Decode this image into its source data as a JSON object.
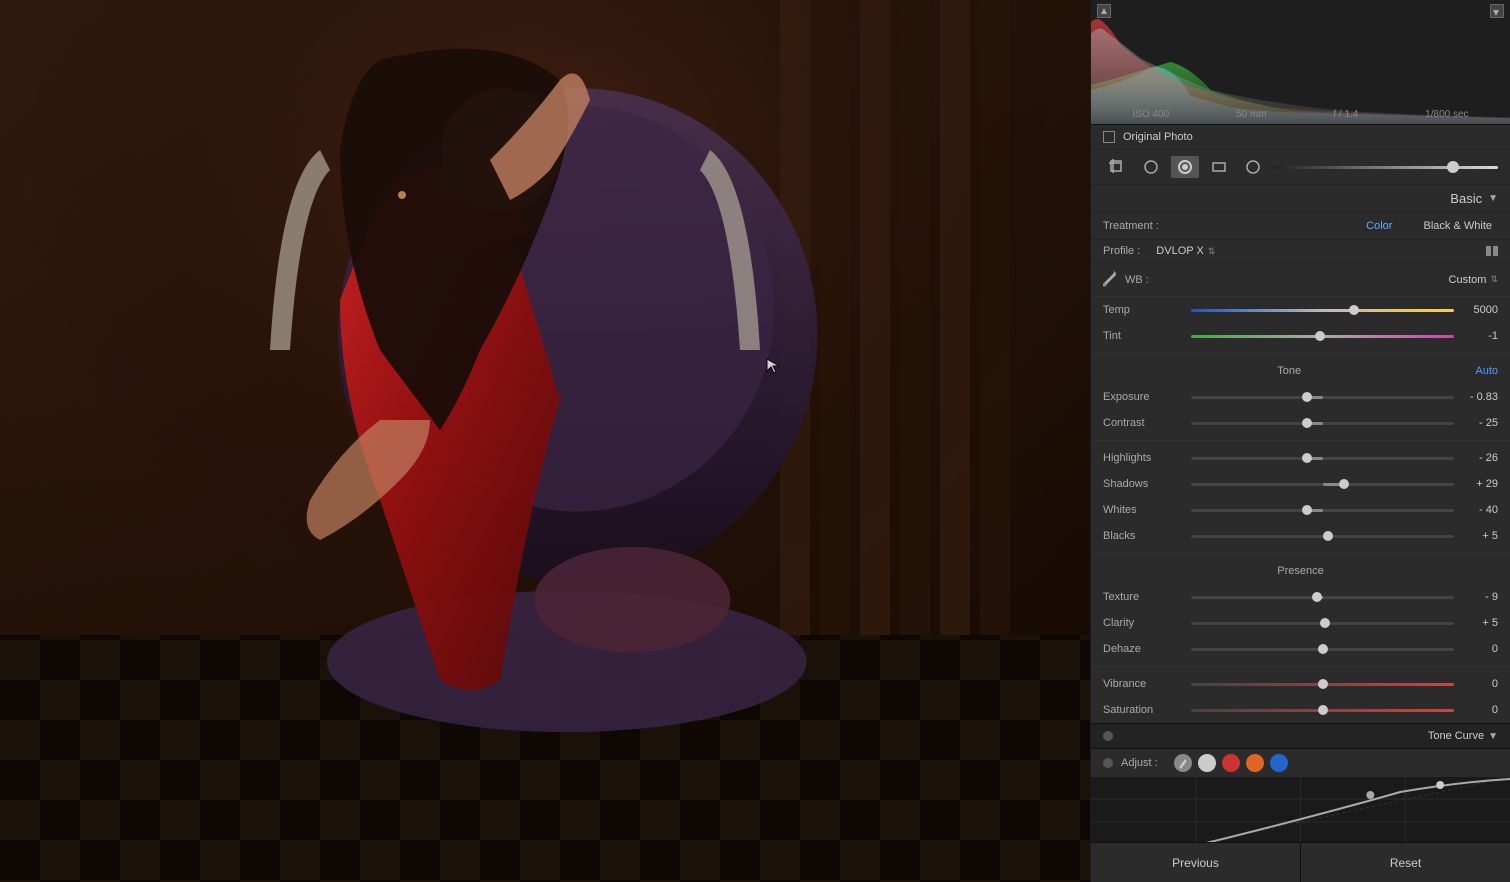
{
  "photo": {
    "alt": "Woman in red dress sitting on ornate chair"
  },
  "histogram": {
    "meta_iso": "ISO 400",
    "meta_focal": "50 mm",
    "meta_aperture": "f / 1.4",
    "meta_shutter": "1/800 sec"
  },
  "original_photo": {
    "label": "Original Photo"
  },
  "panel": {
    "section_title": "Basic",
    "section_title_tone_curve": "Tone Curve",
    "treatment_label": "Treatment :",
    "treatment_color": "Color",
    "treatment_bw": "Black & White",
    "profile_label": "Profile :",
    "profile_value": "DVLOP X",
    "wb_label": "WB :",
    "wb_value": "Custom",
    "temp_label": "Temp",
    "temp_value": "5000",
    "tint_label": "Tint",
    "tint_value": "-1",
    "tone_label": "Tone",
    "auto_label": "Auto",
    "exposure_label": "Exposure",
    "exposure_value": "- 0.83",
    "contrast_label": "Contrast",
    "contrast_value": "- 25",
    "highlights_label": "Highlights",
    "highlights_value": "- 26",
    "shadows_label": "Shadows",
    "shadows_value": "+ 29",
    "whites_label": "Whites",
    "whites_value": "- 40",
    "blacks_label": "Blacks",
    "blacks_value": "+ 5",
    "presence_label": "Presence",
    "texture_label": "Texture",
    "texture_value": "- 9",
    "clarity_label": "Clarity",
    "clarity_value": "+ 5",
    "dehaze_label": "Dehaze",
    "dehaze_value": "0",
    "vibrance_label": "Vibrance",
    "vibrance_value": "0",
    "saturation_label": "Saturation",
    "saturation_value": "0",
    "adjust_label": "Adjust :",
    "previous_label": "Previous",
    "reset_label": "Reset"
  },
  "sliders": {
    "temp_pct": 62,
    "tint_pct": 50,
    "exposure_pct": 44,
    "contrast_pct": 44,
    "highlights_pct": 44,
    "shadows_pct": 58,
    "whites_pct": 44,
    "blacks_pct": 52,
    "texture_pct": 48,
    "clarity_pct": 50,
    "dehaze_pct": 50,
    "vibrance_pct": 50,
    "saturation_pct": 50
  }
}
